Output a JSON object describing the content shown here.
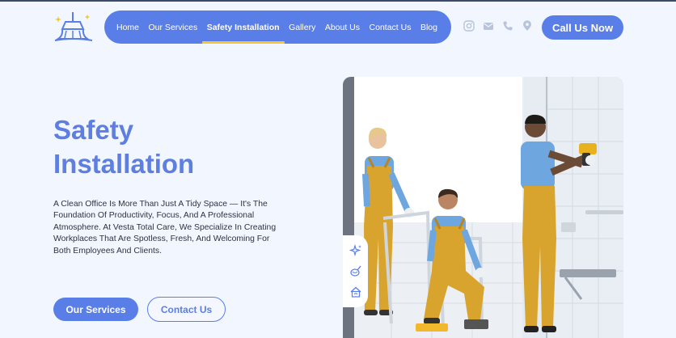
{
  "header": {
    "nav_items": [
      {
        "label": "Home"
      },
      {
        "label": "Our Services"
      },
      {
        "label": "Safety Installation",
        "active": true
      },
      {
        "label": "Gallery"
      },
      {
        "label": "About Us"
      },
      {
        "label": "Contact Us"
      },
      {
        "label": "Blog"
      }
    ],
    "social_icons": [
      "instagram-icon",
      "mail-icon",
      "phone-icon",
      "location-pin-icon"
    ],
    "call_button": "Call Us Now"
  },
  "hero": {
    "title_line1": "Safety",
    "title_line2": "Installation",
    "description": "A Clean Office Is More Than Just A Tidy Space — It's The Foundation Of Productivity, Focus, And A Professional Atmosphere. At Vesta Total Care, We Specialize In Creating Workplaces That Are Spotless, Fresh, And Welcoming For Both Employees And Clients.",
    "primary_button": "Our Services",
    "secondary_button": "Contact Us"
  },
  "side_tools": [
    "sparkle-icon",
    "cleaning-spray-icon",
    "house-cleaning-icon"
  ],
  "colors": {
    "accent": "#5a7ee8",
    "active_underline": "#f4c73b",
    "page_background": "#f1f6ff",
    "uniform_yellow": "#d9a42e",
    "shirt_blue": "#6ea6e0"
  }
}
